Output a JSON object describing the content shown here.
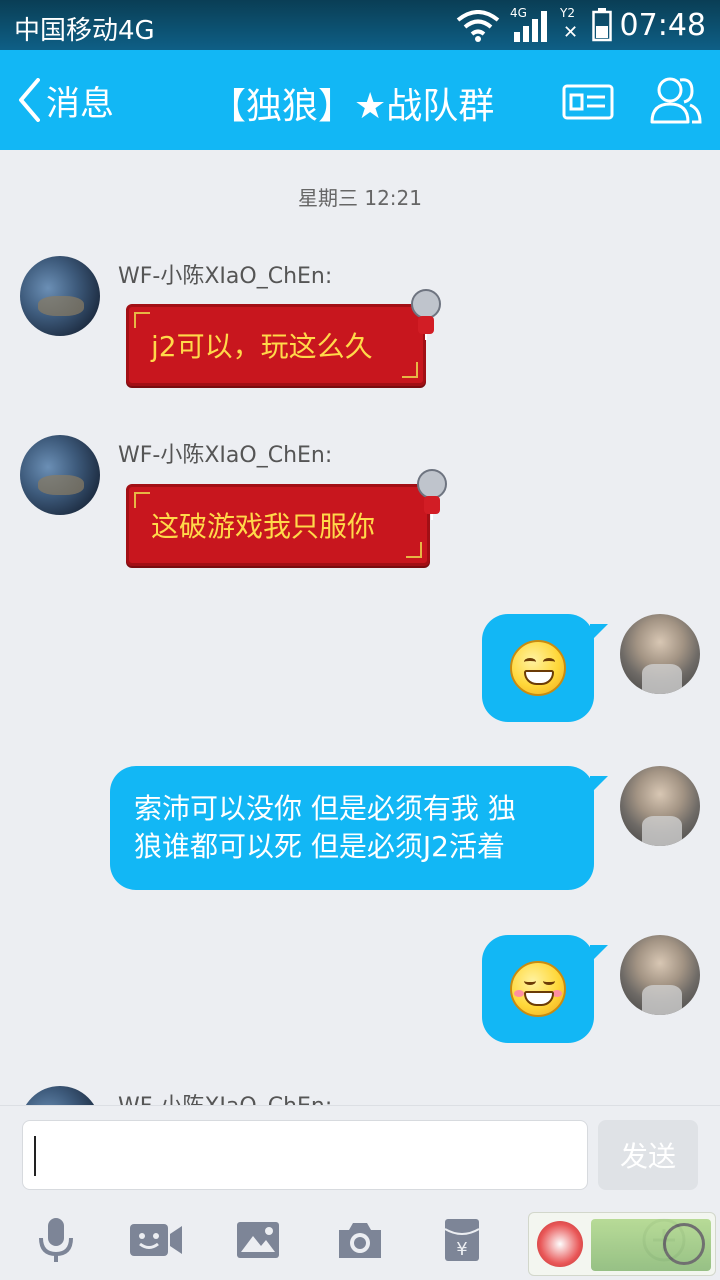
{
  "status_bar": {
    "carrier": "中国移动4G",
    "network_badge": "4G",
    "sim_badge": "Y2",
    "time": "07:48",
    "icons": [
      "wifi-icon",
      "signal-icon",
      "no-sim-icon",
      "battery-icon"
    ]
  },
  "header": {
    "back_label": "消息",
    "title": "【独狼】★战队群",
    "icons": [
      "back-chevron-icon",
      "profile-card-icon",
      "group-members-icon"
    ],
    "background_color": "#12b7f5"
  },
  "chat": {
    "timestamp": "星期三 12:21",
    "messages": [
      {
        "side": "left",
        "sender": "WF-小陈XIaO_ChEn:",
        "text": "j2可以，玩这么久",
        "style": "red-festive-bubble"
      },
      {
        "side": "left",
        "sender": "WF-小陈XIaO_ChEn:",
        "text": "这破游戏我只服你",
        "style": "red-festive-bubble"
      },
      {
        "side": "right",
        "emoji": "grin-emoji-icon"
      },
      {
        "side": "right",
        "text_line1": "索沛可以没你 但是必须有我 独",
        "text_line2": "狼谁都可以死  但是必须J2活着"
      },
      {
        "side": "right",
        "emoji": "blush-grin-emoji-icon"
      },
      {
        "side": "left",
        "sender": "WF-小陈XIaO_ChEn:"
      }
    ],
    "bubble_color": "#12b7f5",
    "red_bubble_color": "#c8161e",
    "red_bubble_text_color": "#ffd94a"
  },
  "input": {
    "value": "",
    "send_label": "发送"
  },
  "toolbar": {
    "items": [
      "microphone-icon",
      "video-call-icon",
      "image-icon",
      "camera-icon",
      "red-packet-icon",
      "plus-icon"
    ]
  }
}
